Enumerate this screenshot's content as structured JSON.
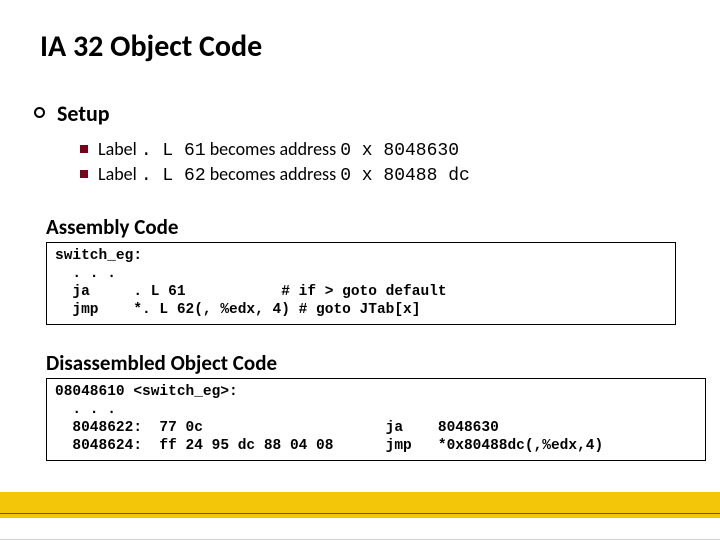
{
  "title": "IA 32 Object Code",
  "bullet_setup": "Setup",
  "subitems": {
    "a_pre": "Label ",
    "a_code": ". L 61",
    "a_post": " becomes address ",
    "a_addr": "0 x 8048630",
    "b_pre": "Label ",
    "b_code": ". L 62",
    "b_post": " becomes address ",
    "b_addr": "0 x 80488 dc"
  },
  "section_asm": "Assembly Code",
  "asm_code": "switch_eg:\n  . . .\n  ja     . L 61           # if > goto default\n  jmp    *. L 62(, %edx, 4) # goto JTab[x]",
  "section_dis": "Disassembled Object Code",
  "dis_code": "08048610 <switch_eg>:\n  . . .\n  8048622:  77 0c                     ja    8048630\n  8048624:  ff 24 95 dc 88 04 08      jmp   *0x80488dc(,%edx,4)"
}
